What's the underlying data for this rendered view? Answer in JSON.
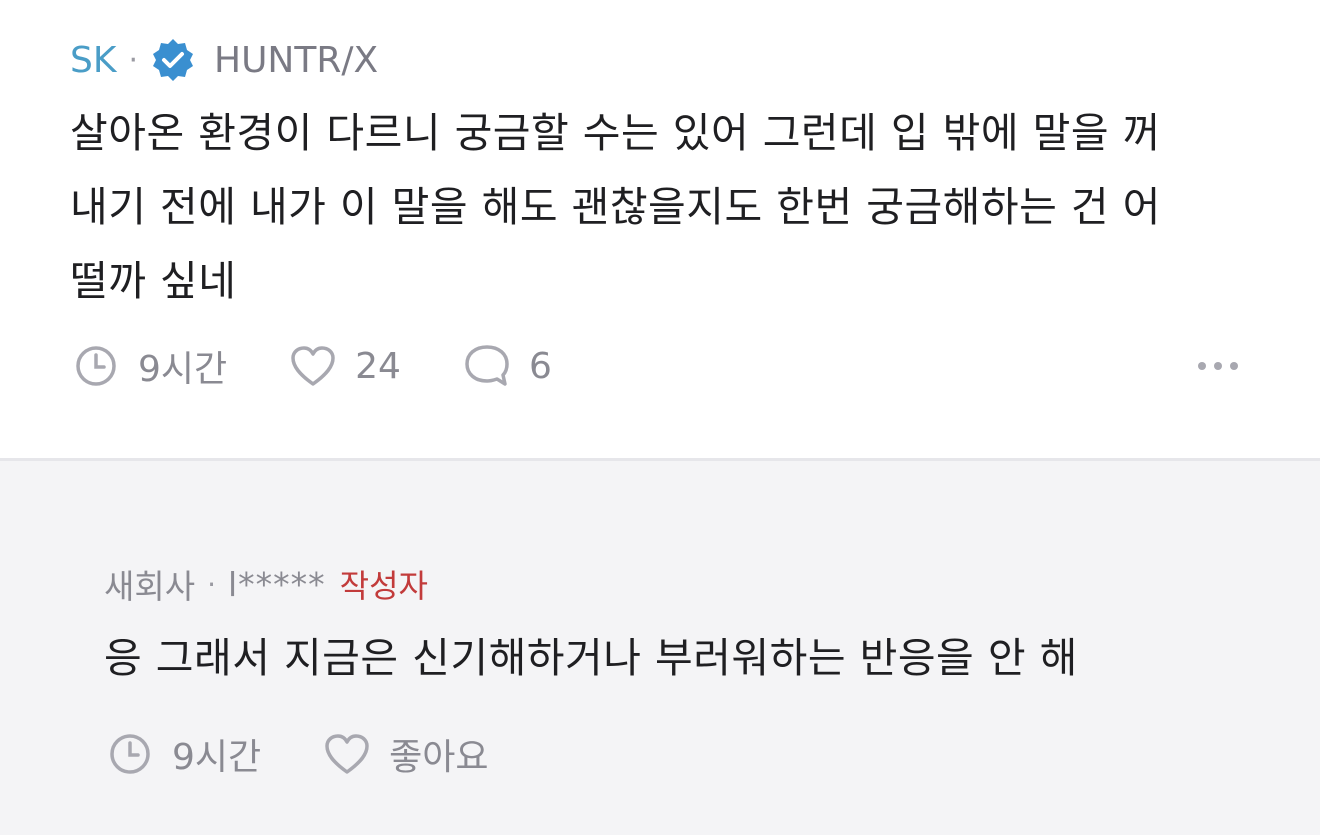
{
  "comment": {
    "company": "SK",
    "separator": "·",
    "nickname": "HUNTR/X",
    "badge_icon": "verified-badge-icon",
    "text_lines": [
      "살아온 환경이 다르니 궁금할 수는 있어 그런데 입 밖에 말을 꺼",
      "내기 전에 내가 이 말을 해도 괜찮을지도 한번 궁금해하는 건 어",
      "떨까 싶네"
    ],
    "time": "9시간",
    "likes": "24",
    "replies": "6",
    "colors": {
      "company": "#4a9dc7",
      "badge": "#3a8fd0"
    }
  },
  "reply": {
    "company": "새회사",
    "separator": "·",
    "nickname": "l*****",
    "author_tag": "작성자",
    "text": "응 그래서 지금은 신기해하거나 부러워하는 반응을 안 해",
    "time": "9시간",
    "like_label": "좋아요",
    "colors": {
      "author_tag": "#c23b3b",
      "background": "#f4f4f6"
    }
  }
}
